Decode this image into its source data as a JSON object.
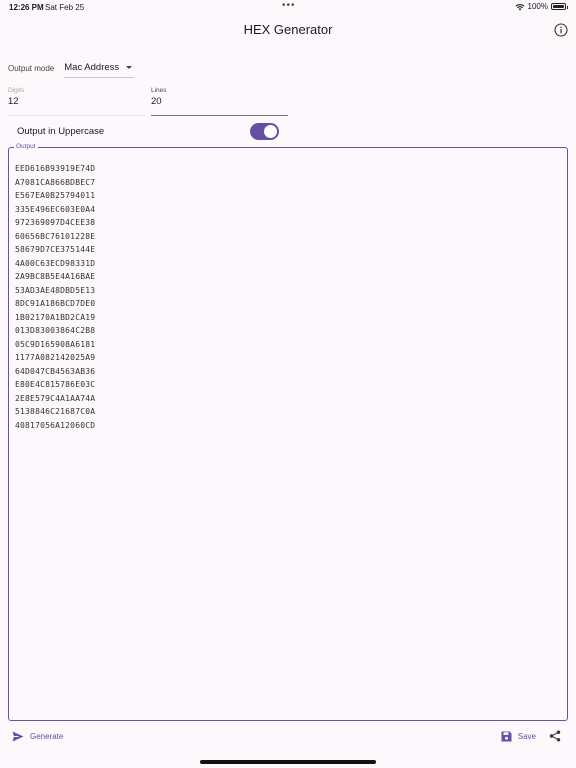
{
  "status_bar": {
    "time": "12:26 PM",
    "date": "Sat Feb 25",
    "dots": "•••",
    "battery": "100%"
  },
  "app_bar": {
    "title": "HEX Generator",
    "info_icon": "info-icon"
  },
  "output_mode": {
    "label": "Output mode",
    "value": "Mac Address"
  },
  "digits": {
    "label": "Digits",
    "value": "12"
  },
  "lines": {
    "label": "Lines",
    "value": "20"
  },
  "uppercase": {
    "label": "Output in Uppercase",
    "enabled": true
  },
  "output": {
    "label": "Output",
    "lines": [
      "EED616B93919E74D",
      "A7081CA866BDBEC7",
      "E567EA0B25794011",
      "335E496EC603E0A4",
      "972369097D4CEE38",
      "60656BC76101228E",
      "58679D7CE375144E",
      "4A00C63ECD98331D",
      "2A9BC8B5E4A16BAE",
      "53AD3AE48DBD5E13",
      "8DC91A186BCD7DE0",
      "1B02170A1BD2CA19",
      "013D83003864C2B8",
      "05C9D165908A6181",
      "1177A082142025A9",
      "64D047CB4563AB36",
      "E80E4C815786E03C",
      "2E8E579C4A1AA74A",
      "5138846C21687C0A",
      "40817056A12060CD"
    ]
  },
  "bottom_bar": {
    "generate_label": "Generate",
    "save_label": "Save"
  },
  "colors": {
    "accent": "#6750a4",
    "background": "#fdf8fc"
  }
}
